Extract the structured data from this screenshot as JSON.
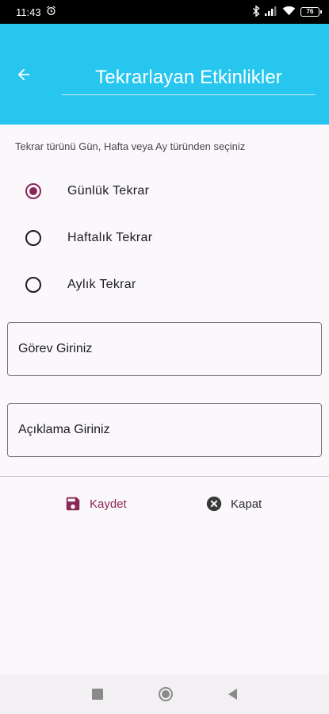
{
  "status_bar": {
    "time": "11:43",
    "battery": "76"
  },
  "app_bar": {
    "title": "Tekrarlayan Etkinlikler"
  },
  "form": {
    "hint": "Tekrar türünü Gün, Hafta veya Ay türünden seçiniz",
    "options": [
      {
        "label": "Günlük Tekrar",
        "selected": true
      },
      {
        "label": "Haftalık Tekrar",
        "selected": false
      },
      {
        "label": "Aylık Tekrar",
        "selected": false
      }
    ],
    "task_field": {
      "placeholder": "Görev Giriniz"
    },
    "description_field": {
      "placeholder": "Açıklama Giriniz"
    }
  },
  "actions": {
    "save_label": "Kaydet",
    "close_label": "Kapat"
  },
  "colors": {
    "app_bar": "#27c6ef",
    "accent": "#8b2756",
    "background": "#fbf8fc"
  }
}
